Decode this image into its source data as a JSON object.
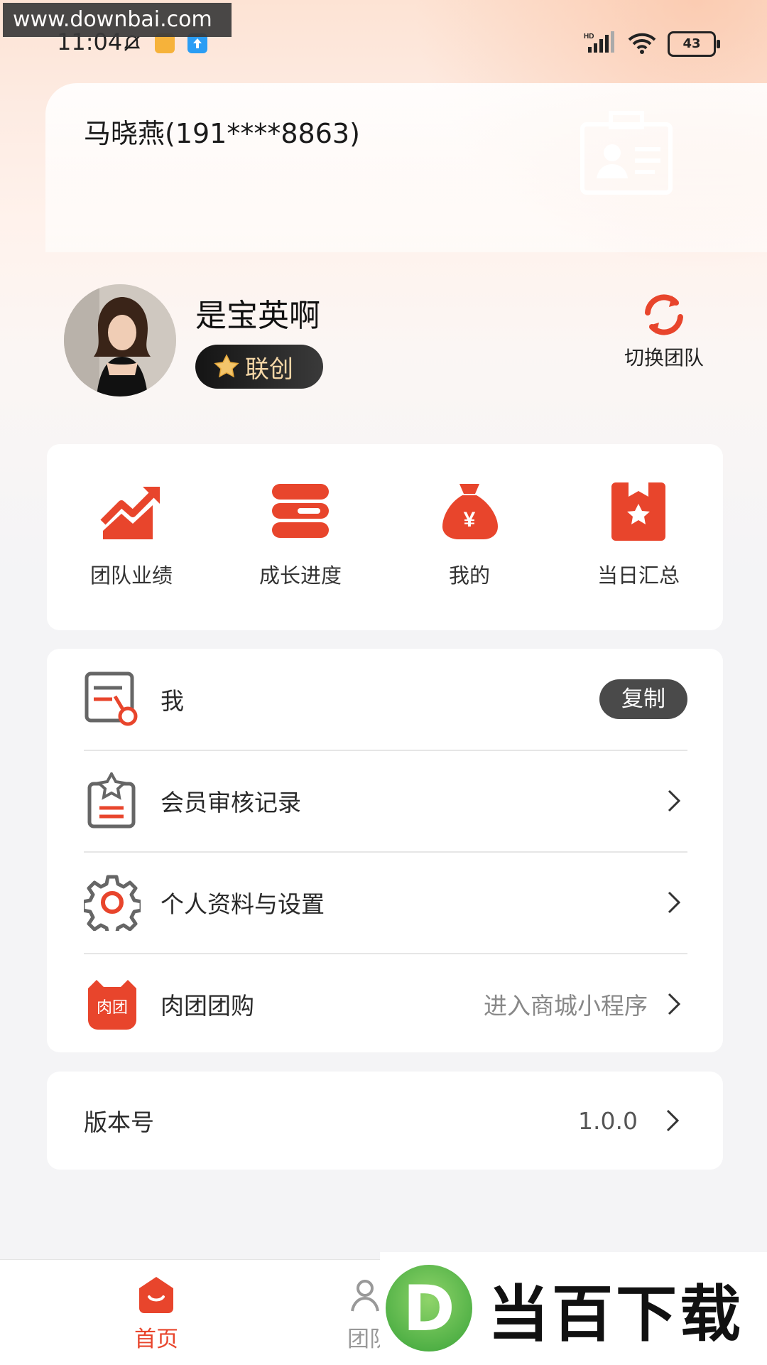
{
  "watermark": {
    "url": "www.downbai.com",
    "brand_logo": "D",
    "brand_text": "当百下载"
  },
  "status_bar": {
    "time": "11:04",
    "network": "HD",
    "battery": "43"
  },
  "account": {
    "name_phone": "马晓燕(191****8863)"
  },
  "profile": {
    "nickname": "是宝英啊",
    "role": "联创",
    "switch_team_label": "切换团队"
  },
  "quick_actions": [
    {
      "label": "团队业绩",
      "icon": "trend-chart-icon"
    },
    {
      "label": "成长进度",
      "icon": "progress-icon"
    },
    {
      "label": "我的",
      "icon": "money-bag-icon"
    },
    {
      "label": "当日汇总",
      "icon": "daily-summary-icon"
    }
  ],
  "menu": {
    "items": [
      {
        "label": "我",
        "value": "",
        "action": "复制",
        "icon": "invite-code-icon"
      },
      {
        "label": "会员审核记录",
        "value": "",
        "icon": "audit-record-icon"
      },
      {
        "label": "个人资料与设置",
        "value": "",
        "icon": "settings-gear-icon"
      },
      {
        "label": "肉团团购",
        "value": "进入商城小程序",
        "icon_text": "肉团",
        "icon": "routuan-logo-icon"
      }
    ]
  },
  "version": {
    "label": "版本号",
    "value": "1.0.0"
  },
  "bottom_nav": [
    {
      "label": "首页",
      "active": true,
      "icon": "home-icon"
    },
    {
      "label": "团队",
      "active": false,
      "icon": "team-icon"
    }
  ],
  "colors": {
    "accent": "#e8452c",
    "badge_dark": "#1e1e1e",
    "gold": "#f4d6a6"
  }
}
